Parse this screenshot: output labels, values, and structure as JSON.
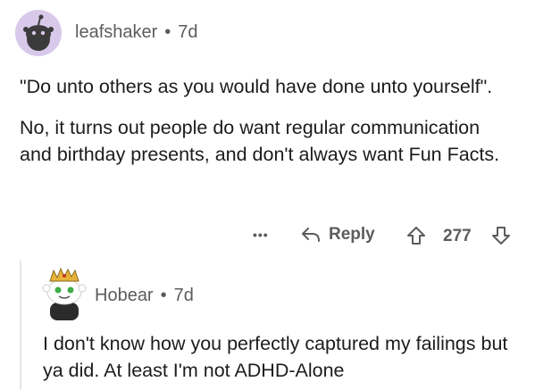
{
  "comments": [
    {
      "username": "leafshaker",
      "separator": "•",
      "time": "7d",
      "paragraphs": [
        "\"Do unto others as you would have done unto yourself\".",
        "No, it turns out people do want regular communication and birthday presents, and don't always want Fun Facts."
      ],
      "actions": {
        "more": "•••",
        "reply_label": "Reply",
        "vote_count": "277"
      }
    },
    {
      "username": "Hobear",
      "separator": "•",
      "time": "7d",
      "paragraphs": [
        "I don't know how you perfectly captured my failings but ya did. At least I'm not ADHD-Alone"
      ]
    }
  ],
  "colors": {
    "avatar1_bg": "#d8c8ea",
    "avatar2_bg": "#e8e8e8",
    "meta_text": "#5c5c5c",
    "body_text": "#1c1c1c"
  }
}
